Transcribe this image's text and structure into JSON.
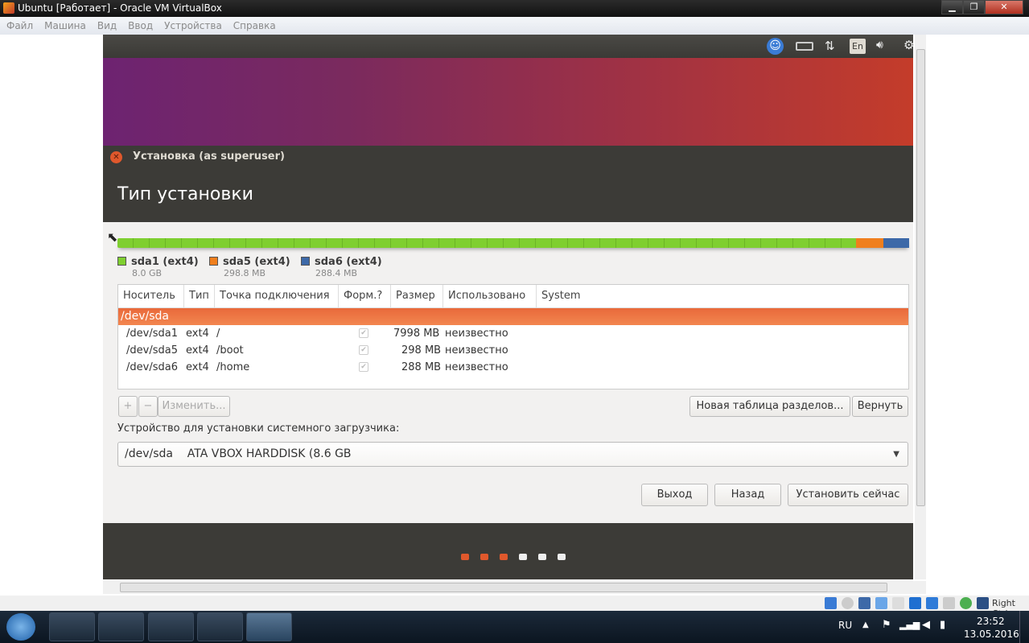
{
  "window": {
    "title": "Ubuntu [Работает] - Oracle VM VirtualBox"
  },
  "menu": [
    "Файл",
    "Машина",
    "Вид",
    "Ввод",
    "Устройства",
    "Справка"
  ],
  "ubuntu_panel": {
    "keyboard_layout": "En"
  },
  "dialog": {
    "title": "Установка (as superuser)",
    "heading": "Тип установки"
  },
  "partition_bar": {
    "segments": [
      {
        "name": "sda1",
        "fraction": 0.93,
        "color": "#7fcf30"
      },
      {
        "name": "sda5",
        "fraction": 0.035,
        "color": "#f07f1d"
      },
      {
        "name": "sda6",
        "fraction": 0.035,
        "color": "#3d69a8"
      }
    ]
  },
  "legend": [
    {
      "label": "sda1 (ext4)",
      "size": "8.0 GB",
      "color": "#7fcf30"
    },
    {
      "label": "sda5 (ext4)",
      "size": "298.8 MB",
      "color": "#f07f1d"
    },
    {
      "label": "sda6 (ext4)",
      "size": "288.4 MB",
      "color": "#3d69a8"
    }
  ],
  "table": {
    "columns": [
      "Носитель",
      "Тип",
      "Точка подключения",
      "Форм.?",
      "Размер",
      "Использовано",
      "System"
    ],
    "device": "/dev/sda",
    "rows": [
      {
        "device": "/dev/sda1",
        "type": "ext4",
        "mount": "/",
        "size": "7998 MB",
        "used": "неизвестно"
      },
      {
        "device": "/dev/sda5",
        "type": "ext4",
        "mount": "/boot",
        "size": "298 MB",
        "used": "неизвестно"
      },
      {
        "device": "/dev/sda6",
        "type": "ext4",
        "mount": "/home",
        "size": "288 MB",
        "used": "неизвестно"
      }
    ]
  },
  "buttons": {
    "add": "+",
    "remove": "−",
    "change": "Изменить...",
    "new_table": "Новая таблица разделов...",
    "revert": "Вернуть",
    "quit": "Выход",
    "back": "Назад",
    "install": "Установить сейчас"
  },
  "bootloader": {
    "label": "Устройство для установки системного загрузчика:",
    "value": "/dev/sda    ATA VBOX HARDDISK (8.6 GB"
  },
  "statusbar": {
    "host_key": "Right Ctrl"
  },
  "taskbar": {
    "language": "RU",
    "time": "23:52",
    "date": "13.05.2016"
  }
}
